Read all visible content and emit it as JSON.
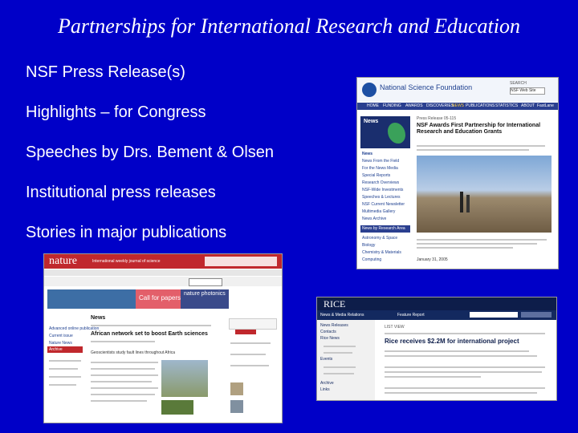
{
  "slide": {
    "title": "Partnerships for International Research and Education",
    "bullets": [
      "NSF Press Release(s)",
      "Highlights – for Congress",
      "Speeches by Drs. Bement & Olsen",
      "Institutional press releases",
      "Stories in major publications"
    ]
  },
  "nsf_shot": {
    "org": "National Science Foundation",
    "search_label": "SEARCH",
    "search_scope": "NSF Web Site",
    "nav": [
      "HOME",
      "FUNDING",
      "AWARDS",
      "DISCOVERIES",
      "NEWS",
      "PUBLICATIONS",
      "STATISTICS",
      "ABOUT",
      "FastLane"
    ],
    "sidebar_header": "News",
    "sidebar_items": [
      "News",
      "News From the Field",
      "For the News Media",
      "Special Reports",
      "Research Overviews",
      "NSF-Wide Investments",
      "Speeches & Lectures",
      "NSF Current Newsletter",
      "Multimedia Gallery",
      "News Archive"
    ],
    "section_header": "News by Research Area",
    "section_items": [
      "Astronomy & Space",
      "Biology",
      "Chemistry & Materials",
      "Computing"
    ],
    "press_label": "Press Release 05-115",
    "headline": "NSF Awards First Partnership for International Research and Education Grants",
    "date": "January 31, 2005"
  },
  "nature_shot": {
    "logo": "nature",
    "tagline": "International weekly journal of science",
    "call_for_papers": "Call for papers",
    "journal": "nature photonics",
    "news_header": "News",
    "headline": "African network set to boost Earth sciences",
    "sub_headline": "Geoscientists study fault lines throughout Africa",
    "sidebar_items": [
      "Advanced online publication",
      "Current issue",
      "Nature News",
      "Archive"
    ]
  },
  "rice_shot": {
    "logo": "RICE",
    "dept": "News & Media Relations",
    "tab": "Feature Report",
    "menu": [
      "News Releases",
      "Contacts",
      "Rice News",
      "Events",
      "Archive",
      "Links"
    ],
    "headline": "Rice receives $2.2M for international project",
    "list_label": "LIST VIEW"
  },
  "colors": {
    "background": "#0000c8",
    "text": "#ffffff",
    "nsf_nav": "#2a3f8f",
    "nature_red": "#c0282d",
    "rice_navy": "#0d1d4a"
  }
}
